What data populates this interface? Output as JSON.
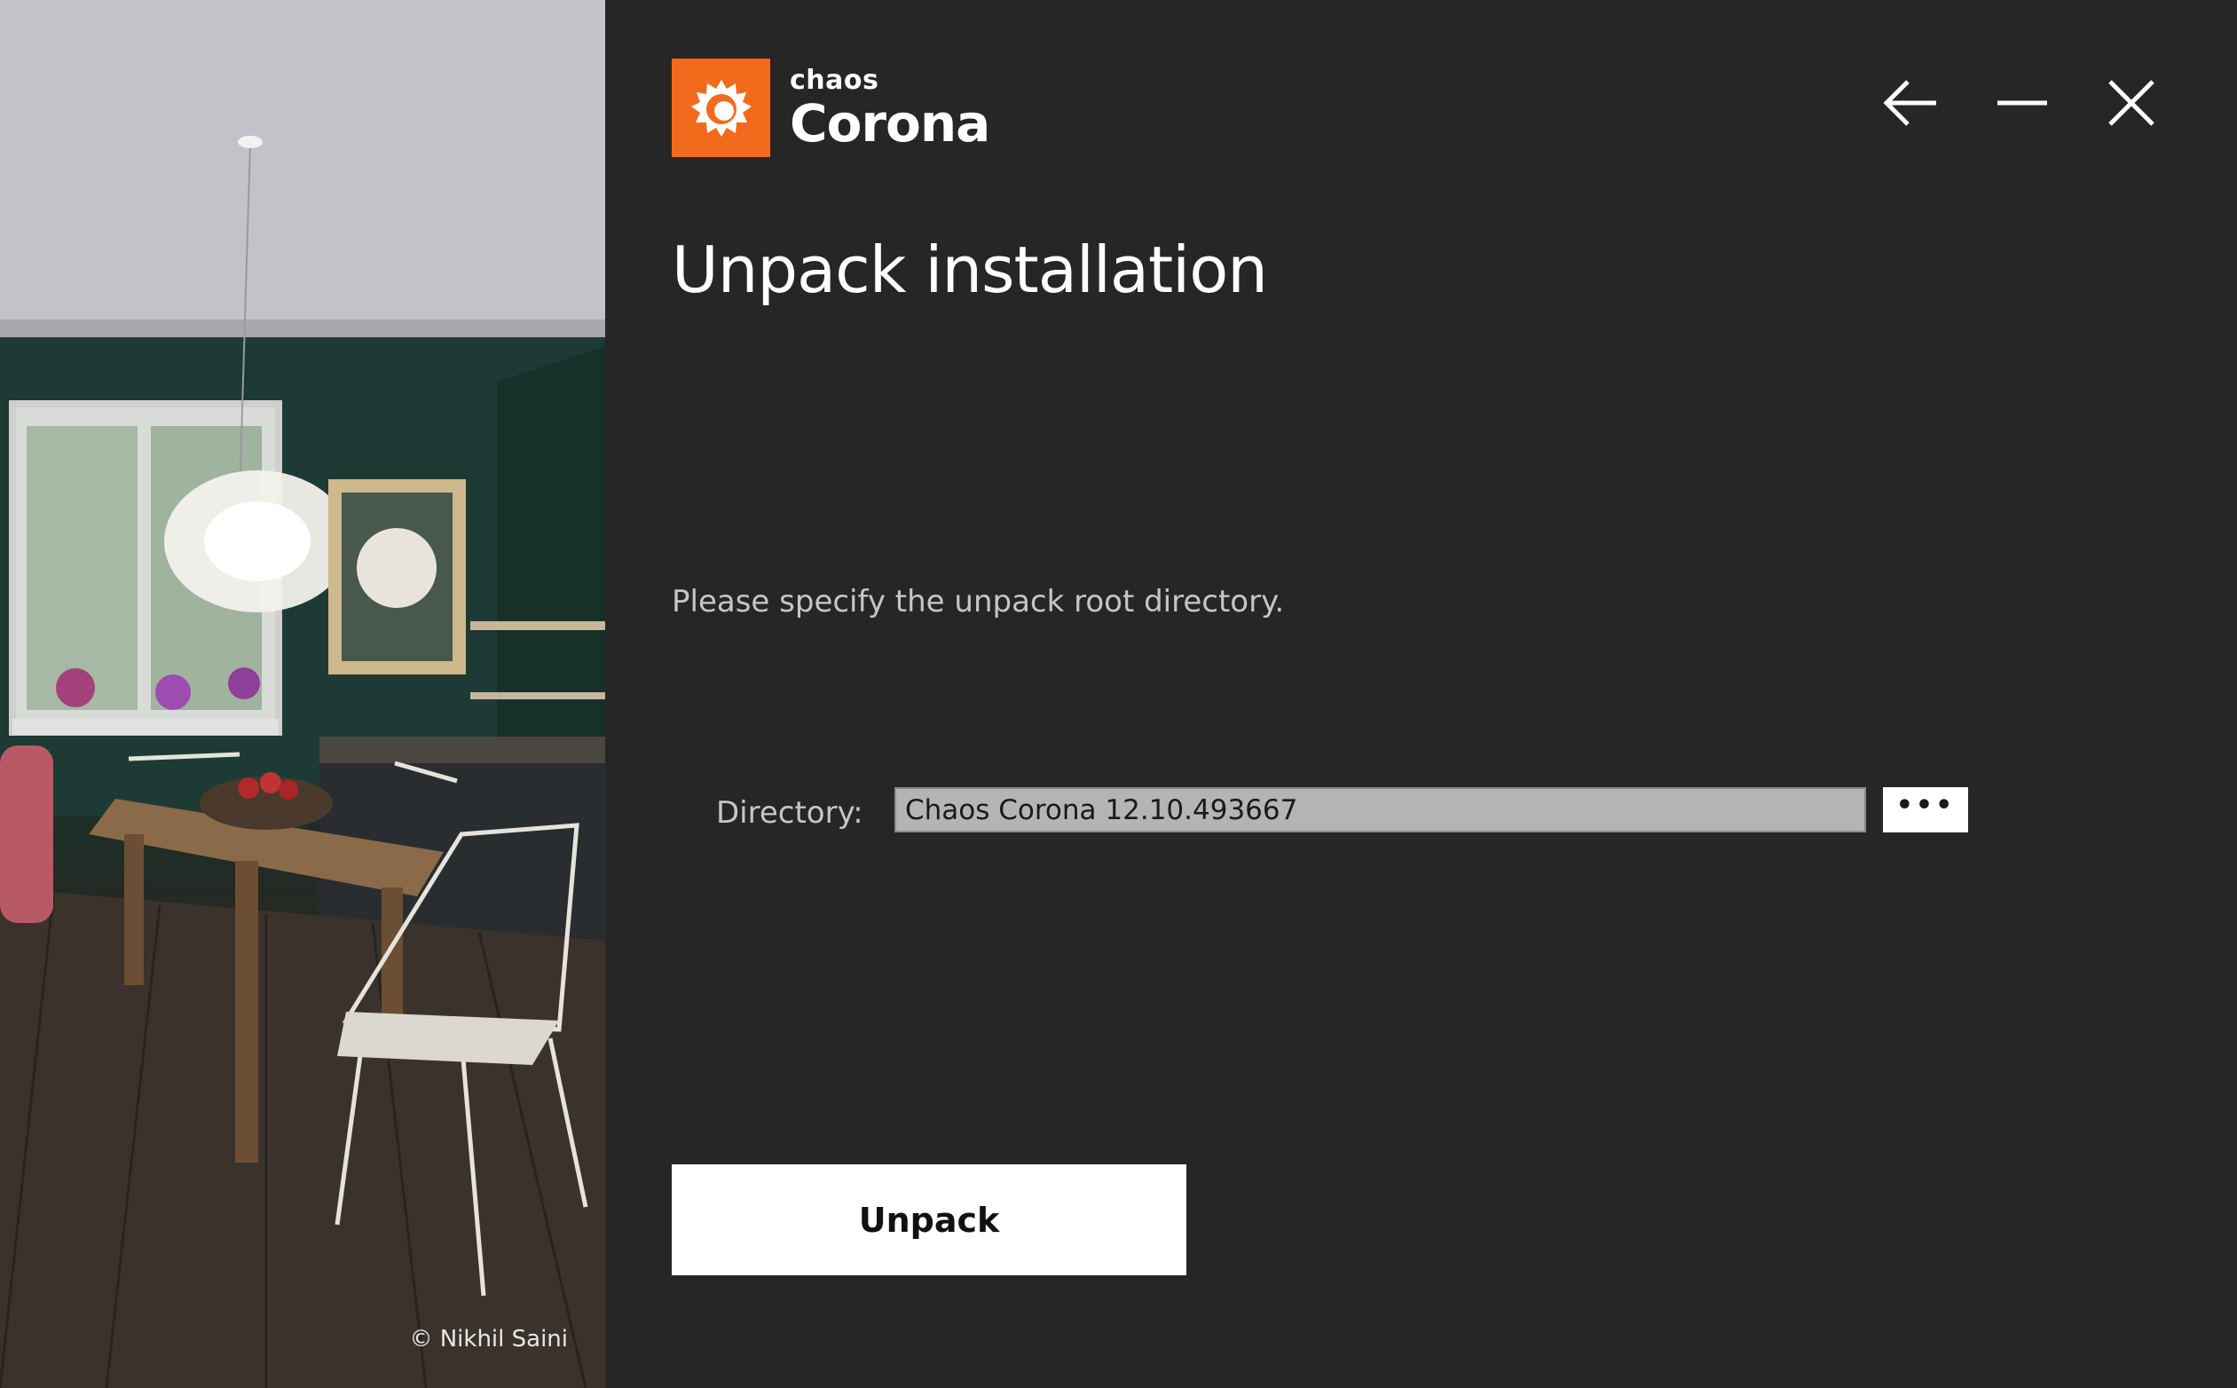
{
  "artwork": {
    "credit": "© Nikhil Saini"
  },
  "logo": {
    "brand": "chaos",
    "product": "Corona",
    "mark_color": "#f26b1d",
    "icon": "corona-flame-icon"
  },
  "window_controls": {
    "back_icon": "arrow-left-icon",
    "minimize_icon": "minimize-icon",
    "close_icon": "close-icon"
  },
  "main": {
    "title": "Unpack installation",
    "prompt": "Please specify the unpack root directory.",
    "directory_label": "Directory:",
    "directory_value": "Chaos Corona 12.10.493667",
    "browse_label": "•••",
    "unpack_label": "Unpack"
  },
  "colors": {
    "background": "#262626",
    "accent": "#f26b1d",
    "button_bg": "#ffffff",
    "input_bg": "#b4b4b4"
  }
}
